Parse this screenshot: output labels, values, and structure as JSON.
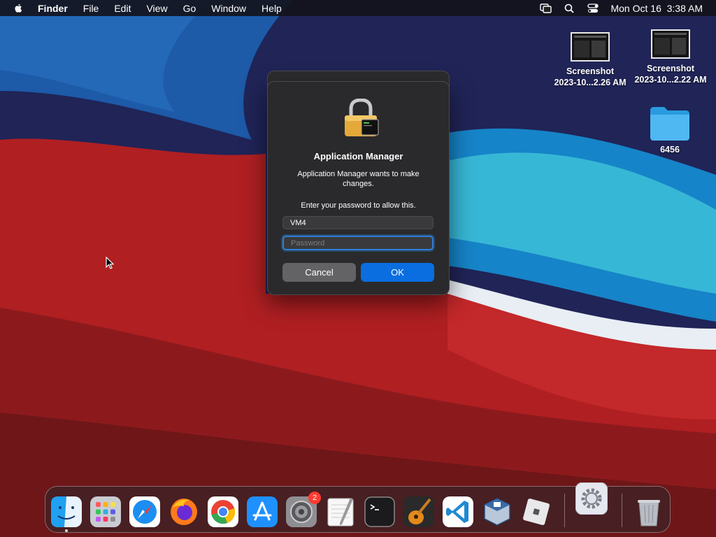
{
  "menubar": {
    "app_name": "Finder",
    "menus": [
      "File",
      "Edit",
      "View",
      "Go",
      "Window",
      "Help"
    ],
    "clock": "Mon Oct 16  3:38 AM",
    "status_icons": [
      "screen-mirroring-icon",
      "search-icon",
      "control-center-icon"
    ]
  },
  "desktop": {
    "items": [
      {
        "label_line1": "Screenshot",
        "label_line2": "2023-10...2.26 AM",
        "icon": "screenshot-thumbnail"
      },
      {
        "label_line1": "Screenshot",
        "label_line2": "2023-10...2.22 AM",
        "icon": "screenshot-thumbnail"
      },
      {
        "label_line1": "6456",
        "label_line2": "",
        "icon": "folder-icon"
      }
    ]
  },
  "dialog": {
    "title": "Application Manager",
    "message": "Application Manager wants to make changes.",
    "prompt": "Enter your password to allow this.",
    "username_value": "VM4",
    "password_placeholder": "Password",
    "cancel_label": "Cancel",
    "ok_label": "OK"
  },
  "dock": {
    "apps": [
      "Finder",
      "Launchpad",
      "Safari",
      "Firefox",
      "Google Chrome",
      "App Store",
      "System Settings",
      "TextEdit",
      "Terminal",
      "GarageBand",
      "Visual Studio Code",
      "VirtualBox",
      "Roblox",
      "System Preferences",
      "Trash"
    ],
    "settings_badge": "2"
  },
  "colors": {
    "accent": "#0a6ee0",
    "badge": "#ff3b30"
  }
}
